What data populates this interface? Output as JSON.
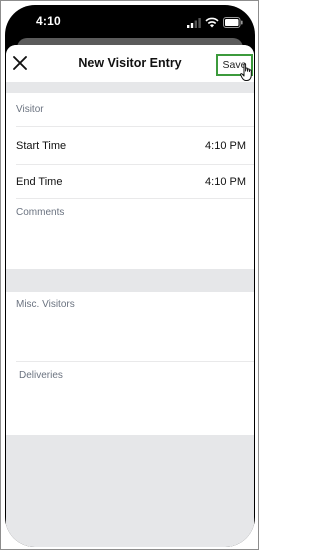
{
  "status_bar": {
    "time": "4:10"
  },
  "nav": {
    "title": "New Visitor Entry",
    "save_label": "Save"
  },
  "form": {
    "visitor_label": "Visitor",
    "start_time_label": "Start Time",
    "start_time_value": "4:10 PM",
    "end_time_label": "End Time",
    "end_time_value": "4:10 PM",
    "comments_label": "Comments",
    "misc_visitors_label": "Misc. Visitors",
    "deliveries_label": "Deliveries"
  },
  "icons": {
    "close": "close-icon",
    "signal": "signal-icon",
    "wifi": "wifi-icon",
    "battery": "battery-icon",
    "cursor": "hand-cursor-icon"
  },
  "colors": {
    "save_highlight": "#3c9a3c",
    "label_gray": "#6b7380",
    "section_gap": "#e6e7e9"
  }
}
